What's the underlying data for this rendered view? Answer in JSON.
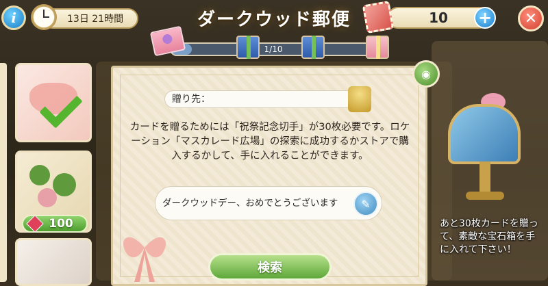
{
  "header": {
    "title": "ダークウッド郵便",
    "timer": "13日 21時間",
    "stamp_count": "10",
    "info_label": "i",
    "plus_label": "+",
    "close_label": "✕"
  },
  "progress": {
    "label": "1/10",
    "fraction": 0.1
  },
  "left_cards": {
    "price": "100"
  },
  "panel": {
    "to_label": "贈り先：",
    "message": "カードを贈るためには「祝祭記念切手」が30枚必要です。ロケーション「マスカレード広場」の探索に成功するかストアで購入するかして、手に入れることができます。",
    "card_message": "ダークウッドデー、おめでとうございます",
    "search_button": "検索"
  },
  "sidebar_reward": {
    "text": "あと30枚カードを贈って、素敵な宝石箱を手に入れて下さい！"
  },
  "icons": {
    "info": "info-icon",
    "clock": "clock-icon",
    "stamp": "stamp-icon",
    "plus": "plus-icon",
    "close": "close-icon",
    "eye": "eye-icon",
    "pen": "pen-icon",
    "gem": "gem-icon"
  }
}
